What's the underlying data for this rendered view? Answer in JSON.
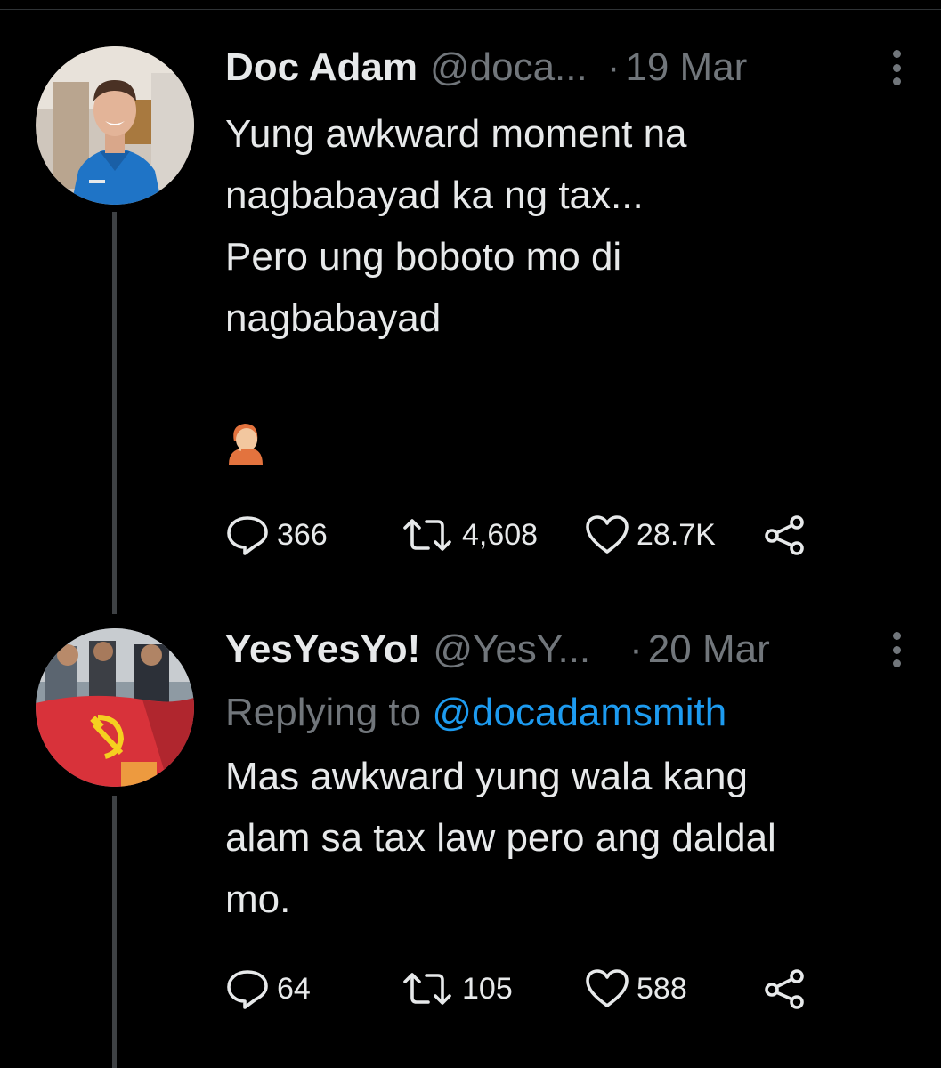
{
  "tweets": [
    {
      "display_name": "Doc Adam",
      "handle": "@doca...",
      "separator": "·",
      "date": "19 Mar",
      "replying_prefix": "",
      "replying_to": "",
      "text_lines": [
        "Yung awkward moment na",
        "nagbabayad ka ng tax...",
        "Pero ung boboto mo di",
        "nagbabayad"
      ],
      "emoji": "facepalm-emoji",
      "stats": {
        "replies": "366",
        "retweets": "4,608",
        "likes": "28.7K"
      }
    },
    {
      "display_name": "YesYesYo!",
      "handle": "@YesY...",
      "separator": "·",
      "date": "20 Mar",
      "replying_prefix": "Replying to",
      "replying_to": "@docadamsmith",
      "text_lines": [
        "Mas awkward yung wala kang",
        "alam sa tax law pero ang daldal",
        "mo."
      ],
      "stats": {
        "replies": "64",
        "retweets": "105",
        "likes": "588"
      }
    }
  ],
  "icons": {
    "reply": "reply-icon",
    "retweet": "retweet-icon",
    "like": "heart-icon",
    "share": "share-icon",
    "more": "more-icon"
  },
  "colors": {
    "background": "#000000",
    "primary_text": "#e7e9ea",
    "secondary_text": "#71767b",
    "mention": "#1d9bf0",
    "thread_line": "#3e4144"
  }
}
